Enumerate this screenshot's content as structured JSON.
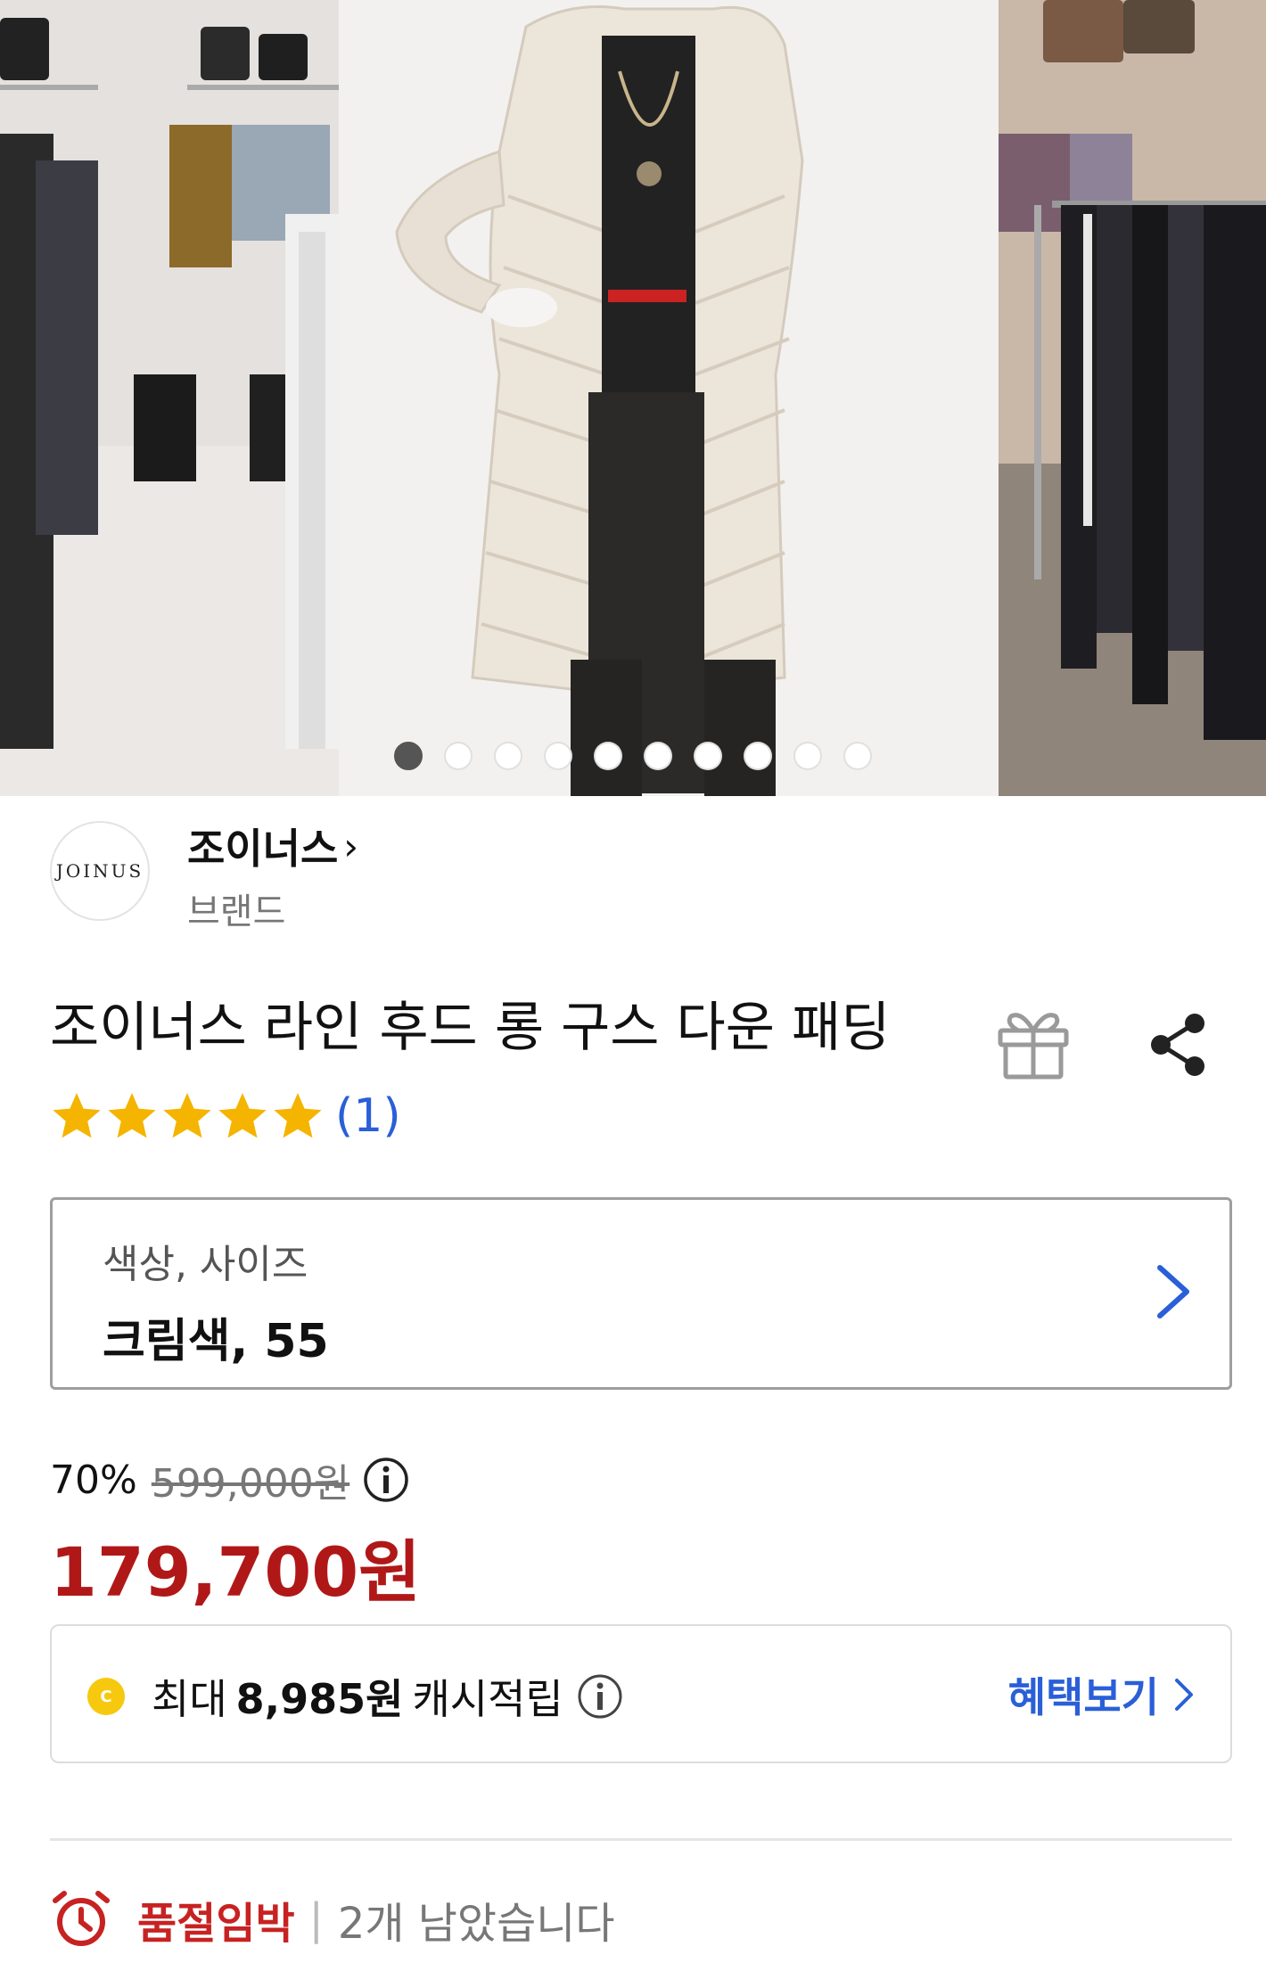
{
  "product_image": {
    "alt": "mannequin wearing cream long goose down padded coat",
    "slide_count": 10,
    "active_slide": 1
  },
  "brand": {
    "logo_text": "JOINUS",
    "name": "조이너스",
    "sub_label": "브랜드"
  },
  "product": {
    "title": "조이너스 라인 후드 롱 구스 다운 패딩",
    "rating_stars": 5,
    "review_count": "(1)"
  },
  "option": {
    "label": "색상, 사이즈",
    "value": "크림색, 55"
  },
  "price": {
    "discount": "70%",
    "original": "599,000원",
    "sale": "179,700원"
  },
  "cashback": {
    "coin_symbol": "C",
    "prefix": "최대",
    "amount": "8,985원",
    "suffix": "캐시적립",
    "benefit_link": "혜택보기"
  },
  "stock": {
    "status": "품절임박",
    "separator": "|",
    "remaining": "2개 남았습니다"
  },
  "colors": {
    "sale_red": "#b01818",
    "link_blue": "#2a5fd8",
    "soldout_red": "#c72222",
    "star_yellow": "#f5b400",
    "coin_yellow": "#f6c90e"
  }
}
